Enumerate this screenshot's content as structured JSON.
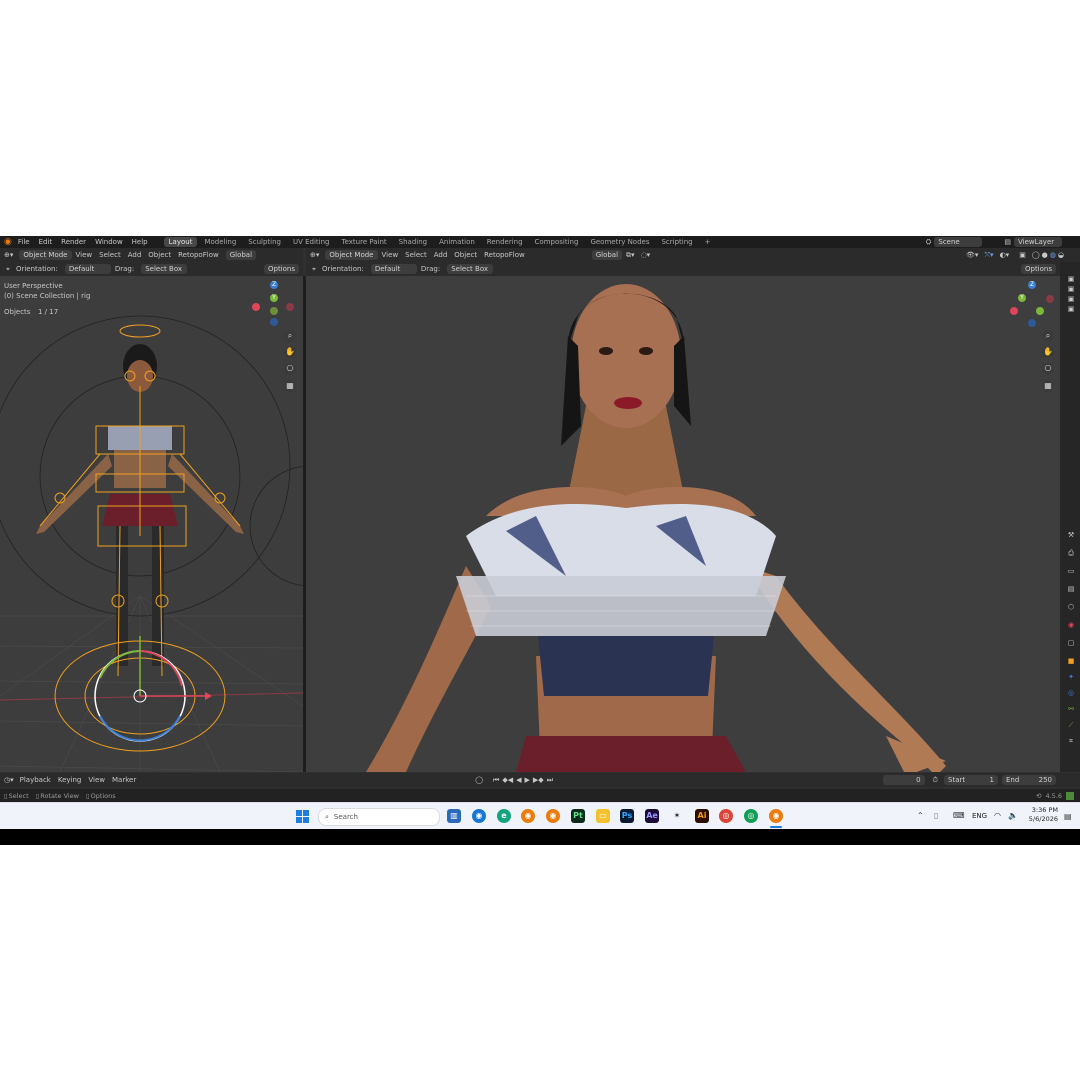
{
  "menu": {
    "items": [
      "File",
      "Edit",
      "Render",
      "Window",
      "Help"
    ],
    "workspaces": [
      "Layout",
      "Modeling",
      "Sculpting",
      "UV Editing",
      "Texture Paint",
      "Shading",
      "Animation",
      "Rendering",
      "Compositing",
      "Geometry Nodes",
      "Scripting"
    ],
    "active_workspace": "Layout",
    "add_tab": "+",
    "scene": "Scene",
    "view_layer": "ViewLayer"
  },
  "left_header": {
    "mode": "Object Mode",
    "items": [
      "View",
      "Select",
      "Add",
      "Object"
    ],
    "addon": "RetopoFlow",
    "transform": "Global",
    "orientation_label": "Orientation:",
    "orientation_value": "Default",
    "drag_label": "Drag:",
    "drag_value": "Select Box",
    "options": "Options"
  },
  "right_header": {
    "mode": "Object Mode",
    "items": [
      "View",
      "Select",
      "Add",
      "Object"
    ],
    "addon": "RetopoFlow",
    "transform": "Global",
    "orientation_label": "Orientation:",
    "orientation_value": "Default",
    "drag_label": "Drag:",
    "drag_value": "Select Box",
    "options": "Options"
  },
  "left_viewport": {
    "perspective": "User Perspective",
    "collection": "(0) Scene Collection | rig",
    "objects_label": "Objects",
    "objects_count": "1 / 17"
  },
  "gizmo": {
    "z": "Z",
    "y": "Y",
    "x": "X"
  },
  "timeline": {
    "items": [
      "Playback",
      "Keying",
      "View",
      "Marker"
    ],
    "current_frame": "0",
    "start_label": "Start",
    "start": "1",
    "end_label": "End",
    "end": "250"
  },
  "status": {
    "select": "Select",
    "rotate": "Rotate View",
    "options": "Options",
    "version": "4.5.6"
  },
  "taskbar": {
    "search_placeholder": "Search",
    "lang": "ENG",
    "time": "3:36 PM",
    "date": "5/6/2026",
    "app_labels": {
      "pt": "Pt",
      "ps": "Ps",
      "ae": "Ae",
      "ai": "Ai"
    }
  },
  "colors": {
    "accent_orange": "#f0a020",
    "axis_x": "#e0445b",
    "axis_y": "#7bb83a",
    "axis_z": "#3a7fd5",
    "ui_bg": "#303030"
  }
}
